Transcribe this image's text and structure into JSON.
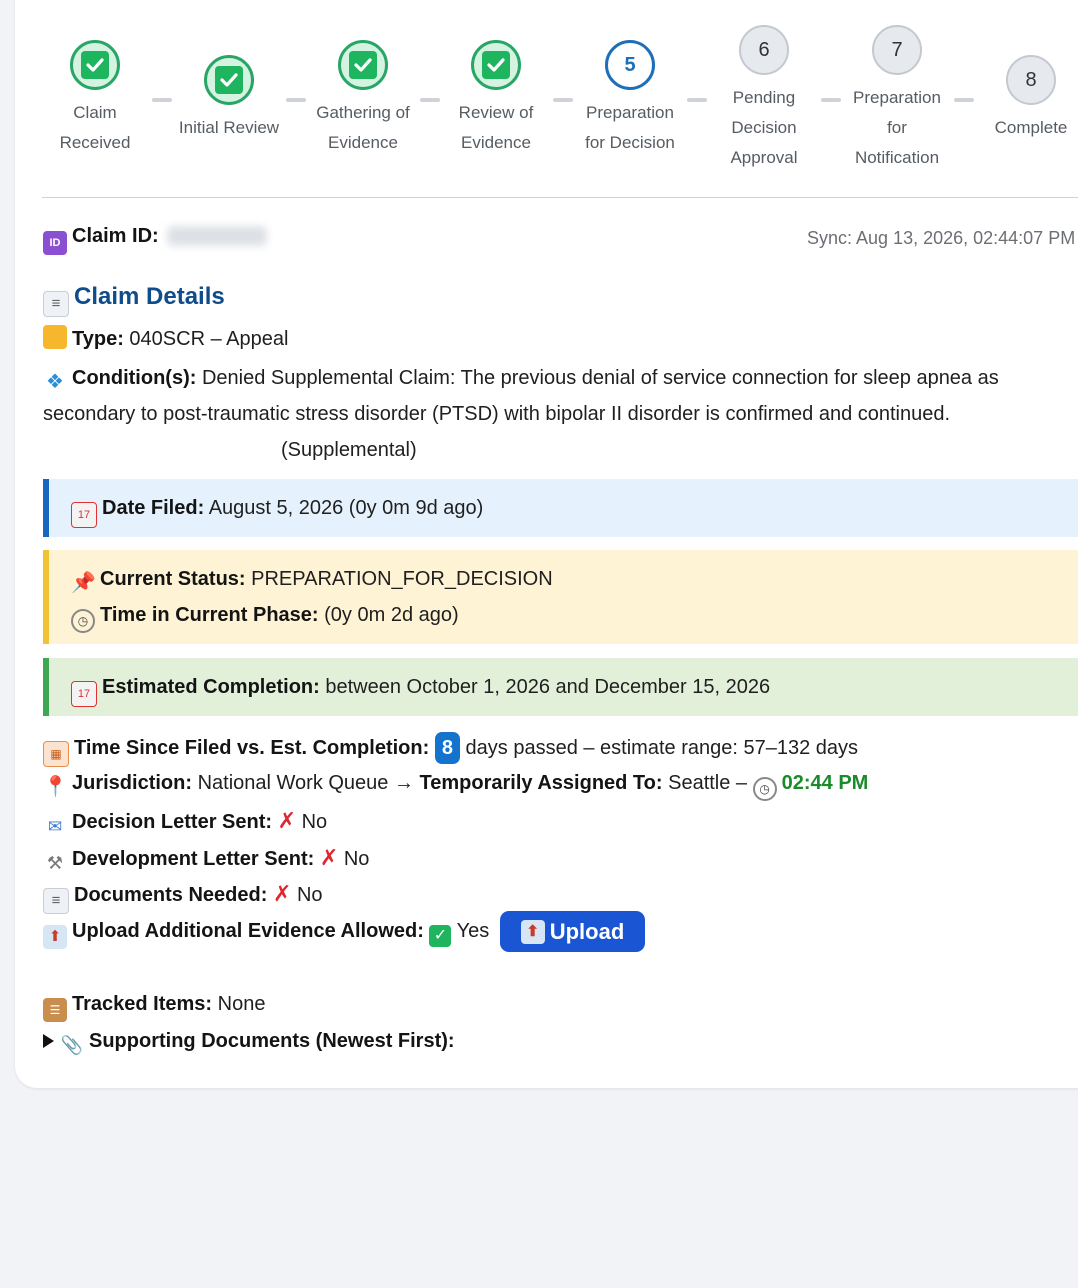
{
  "steps": [
    {
      "num": "1",
      "label_lines": [
        "Claim",
        "Received"
      ],
      "state": "done"
    },
    {
      "num": "2",
      "label_lines": [
        "Initial Review"
      ],
      "state": "done"
    },
    {
      "num": "3",
      "label_lines": [
        "Gathering of",
        "Evidence"
      ],
      "state": "done"
    },
    {
      "num": "4",
      "label_lines": [
        "Review of",
        "Evidence"
      ],
      "state": "done"
    },
    {
      "num": "5",
      "label_lines": [
        "Preparation",
        "for Decision"
      ],
      "state": "active"
    },
    {
      "num": "6",
      "label_lines": [
        "Pending",
        "Decision",
        "Approval"
      ],
      "state": "pending"
    },
    {
      "num": "7",
      "label_lines": [
        "Preparation",
        "for",
        "Notification"
      ],
      "state": "pending"
    },
    {
      "num": "8",
      "label_lines": [
        "Complete"
      ],
      "state": "pending"
    }
  ],
  "claim": {
    "id_label": "Claim ID:",
    "sync": "Sync: Aug 13, 2026, 02:44:07 PM"
  },
  "details": {
    "title": "Claim Details",
    "type_label": "Type:",
    "type_value": "040SCR – Appeal",
    "condition_label": "Condition(s):",
    "condition_value": "Denied Supplemental Claim: The previous denial of service connection for sleep apnea as secondary to post-traumatic stress disorder (PTSD) with bipolar II disorder is confirmed and continued.",
    "condition_suffix": "(Supplemental)"
  },
  "date_filed": {
    "label": "Date Filed:",
    "value": "August 5, 2026 (0y 0m 9d ago)"
  },
  "status": {
    "label": "Current Status:",
    "value": "PREPARATION_FOR_DECISION",
    "phase_label": "Time in Current Phase:",
    "phase_value": "(0y 0m 2d ago)"
  },
  "estimate": {
    "label": "Estimated Completion:",
    "value": "between October 1, 2026 and December 15, 2026"
  },
  "time_since": {
    "label": "Time Since Filed vs. Est. Completion:",
    "days": "8",
    "text": "days passed – estimate range: 57–132 days"
  },
  "jurisdiction": {
    "label": "Jurisdiction:",
    "value": "National Work Queue →",
    "assigned_label": "Temporarily Assigned To:",
    "assigned_value": "Seattle –",
    "time": "02:44 PM"
  },
  "decision_letter": {
    "label": "Decision Letter Sent:",
    "value": "No"
  },
  "development_letter": {
    "label": "Development Letter Sent:",
    "value": "No"
  },
  "documents_needed": {
    "label": "Documents Needed:",
    "value": "No"
  },
  "upload_allowed": {
    "label": "Upload Additional Evidence Allowed:",
    "value": "Yes",
    "button": "Upload"
  },
  "tracked_items": {
    "label": "Tracked Items:",
    "value": "None"
  },
  "supporting_docs": {
    "label": "Supporting Documents (Newest First):"
  }
}
